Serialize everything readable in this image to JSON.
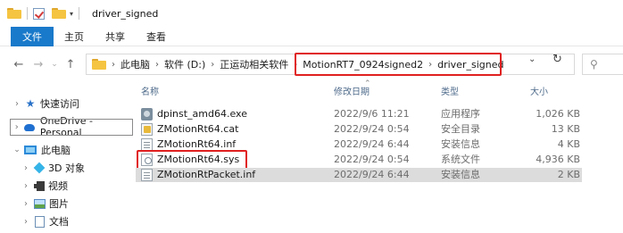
{
  "window": {
    "title": "driver_signed"
  },
  "ribbon": {
    "tabs": [
      "文件",
      "主页",
      "共享",
      "查看"
    ]
  },
  "address": {
    "crumbs": [
      "此电脑",
      "软件 (D:)",
      "正运动相关软件",
      "MotionRT7_0924signed2",
      "driver_signed"
    ],
    "search_icon": "search-icon",
    "refresh_icon": "refresh-icon"
  },
  "nav": {
    "items": [
      {
        "label": "快速访问",
        "icon": "star-icon"
      },
      {
        "label": "OneDrive - Personal",
        "icon": "cloud-icon"
      },
      {
        "label": "此电脑",
        "icon": "pc-icon"
      },
      {
        "label": "3D 对象",
        "icon": "3d-object-icon"
      },
      {
        "label": "视频",
        "icon": "video-icon"
      },
      {
        "label": "图片",
        "icon": "picture-icon"
      },
      {
        "label": "文档",
        "icon": "document-icon"
      }
    ]
  },
  "list": {
    "headers": {
      "name": "名称",
      "date": "修改日期",
      "type": "类型",
      "size": "大小"
    },
    "files": [
      {
        "name": "dpinst_amd64.exe",
        "date": "2022/9/6 11:21",
        "type": "应用程序",
        "size": "1,026 KB",
        "icon": "exe-icon"
      },
      {
        "name": "ZMotionRt64.cat",
        "date": "2022/9/24 0:54",
        "type": "安全目录",
        "size": "13 KB",
        "icon": "security-catalog-icon"
      },
      {
        "name": "ZMotionRt64.inf",
        "date": "2022/9/24 6:44",
        "type": "安装信息",
        "size": "4 KB",
        "icon": "inf-file-icon"
      },
      {
        "name": "ZMotionRt64.sys",
        "date": "2022/9/24 0:54",
        "type": "系统文件",
        "size": "4,936 KB",
        "icon": "sys-file-icon"
      },
      {
        "name": "ZMotionRtPacket.inf",
        "date": "2022/9/24 6:44",
        "type": "安装信息",
        "size": "2 KB",
        "icon": "inf-file-icon"
      }
    ]
  },
  "colors": {
    "accent": "#1979ca",
    "highlight_box": "#e02020",
    "selected_row": "#dcdcdc"
  }
}
